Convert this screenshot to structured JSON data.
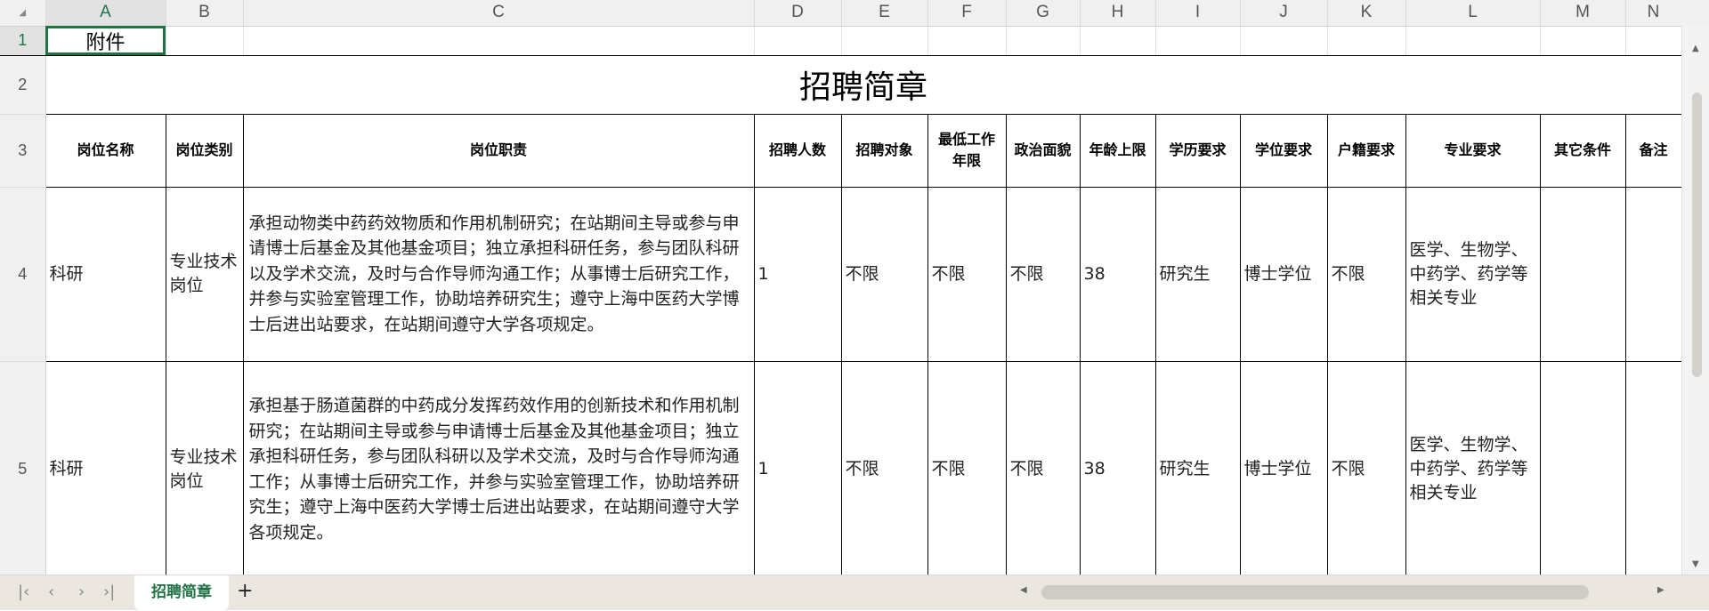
{
  "columns": [
    "A",
    "B",
    "C",
    "D",
    "E",
    "F",
    "G",
    "H",
    "I",
    "J",
    "K",
    "L",
    "M",
    "N"
  ],
  "rows": [
    "1",
    "2",
    "3",
    "4",
    "5"
  ],
  "cell_a1": "附件",
  "title": "招聘简章",
  "headers": [
    "岗位名称",
    "岗位类别",
    "岗位职责",
    "招聘人数",
    "招聘对象",
    "最低工作年限",
    "政治面貌",
    "年龄上限",
    "学历要求",
    "学位要求",
    "户籍要求",
    "专业要求",
    "其它条件",
    "备注"
  ],
  "records": [
    {
      "name": "科研",
      "category": "专业技术岗位",
      "duty": "承担动物类中药药效物质和作用机制研究；在站期间主导或参与申请博士后基金及其他基金项目；独立承担科研任务，参与团队科研以及学术交流，及时与合作导师沟通工作；从事博士后研究工作，并参与实验室管理工作，协助培养研究生；遵守上海中医药大学博士后进出站要求，在站期间遵守大学各项规定。",
      "count": "1",
      "target": "不限",
      "min_years": "不限",
      "political": "不限",
      "age_max": "38",
      "education": "研究生",
      "degree": "博士学位",
      "hukou": "不限",
      "major": "医学、生物学、中药学、药学等相关专业",
      "other": "",
      "note": ""
    },
    {
      "name": "科研",
      "category": "专业技术岗位",
      "duty": "承担基于肠道菌群的中药成分发挥药效作用的创新技术和作用机制研究；在站期间主导或参与申请博士后基金及其他基金项目；独立承担科研任务，参与团队科研以及学术交流，及时与合作导师沟通工作；从事博士后研究工作，并参与实验室管理工作，协助培养研究生；遵守上海中医药大学博士后进出站要求，在站期间遵守大学各项规定。",
      "count": "1",
      "target": "不限",
      "min_years": "不限",
      "political": "不限",
      "age_max": "38",
      "education": "研究生",
      "degree": "博士学位",
      "hukou": "不限",
      "major": "医学、生物学、中药学、药学等相关专业",
      "other": "",
      "note": ""
    }
  ],
  "sheet_tab": "招聘简章",
  "add_sheet": "+",
  "accent": "#217346"
}
